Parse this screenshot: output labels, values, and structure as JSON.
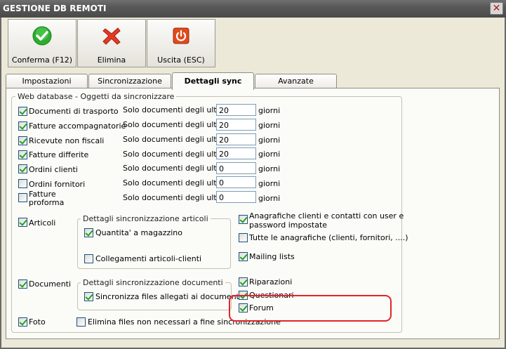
{
  "window": {
    "title": "GESTIONE DB REMOTI",
    "close_glyph": "✕"
  },
  "toolbar": {
    "confirm_label": "Conferma (F12)",
    "delete_label": "Elimina",
    "exit_label": "Uscita (ESC)"
  },
  "tabs": [
    "Impostazioni",
    "Sincronizzazione",
    "Dettagli sync",
    "Avanzate"
  ],
  "active_tab": "Dettagli sync",
  "group_main": {
    "legend": "Web database - Oggetti da sincronizzare"
  },
  "docs": [
    {
      "label": "Documenti di trasporto",
      "checked": true,
      "prefix": "Solo documenti degli ultimi",
      "days": "20",
      "suffix": "giorni"
    },
    {
      "label": "Fatture accompagnatorie",
      "checked": true,
      "prefix": "Solo documenti degli ultimi",
      "days": "20",
      "suffix": "giorni"
    },
    {
      "label": "Ricevute non fiscali",
      "checked": true,
      "prefix": "Solo documenti degli ultimi",
      "days": "20",
      "suffix": "giorni"
    },
    {
      "label": "Fatture differite",
      "checked": true,
      "prefix": "Solo documenti degli ultimi",
      "days": "20",
      "suffix": "giorni"
    },
    {
      "label": "Ordini clienti",
      "checked": true,
      "prefix": "Solo documenti degli ultimi",
      "days": "0",
      "suffix": "giorni"
    },
    {
      "label": "Ordini fornitori",
      "checked": false,
      "prefix": "Solo documenti degli ultimi",
      "days": "0",
      "suffix": "giorni"
    },
    {
      "label_line1": "Fatture",
      "label_line2": "proforma",
      "checked": false,
      "prefix": "Solo documenti degli ultimi",
      "days": "0",
      "suffix": "giorni"
    }
  ],
  "articoli": {
    "label": "Articoli",
    "checked": true,
    "group_legend": "Dettagli sincronizzazione articoli",
    "quantita_label": "Quantita' a magazzino",
    "quantita_checked": true,
    "collegamenti_label": "Collegamenti articoli-clienti",
    "collegamenti_checked": false
  },
  "documenti": {
    "label": "Documenti",
    "checked": true,
    "group_legend": "Dettagli sincronizzazione documenti",
    "allegati_label": "Sincronizza files allegati ai documenti",
    "allegati_checked": true
  },
  "foto": {
    "label": "Foto",
    "checked": true,
    "elimina_label": "Elimina files non necessari a fine sincronizzazione",
    "elimina_checked": false
  },
  "right_options": {
    "anagrafiche_line1": "Anagrafiche clienti e contatti con user e",
    "anagrafiche_line2": "password impostate",
    "anagrafiche_checked": true,
    "tutte_label": "Tutte le anagrafiche (clienti, fornitori, ....)",
    "tutte_checked": false,
    "mailing_label": "Mailing lists",
    "mailing_checked": true,
    "riparazioni_label": "Riparazioni",
    "riparazioni_checked": true,
    "questionari_label": "Questionari",
    "questionari_checked": true,
    "forum_label": "Forum",
    "forum_checked": true
  },
  "colors": {
    "highlight": "#e0252b",
    "check": "#21a121",
    "confirm_icon": "#2cae2c",
    "delete_icon": "#e23a22",
    "exit_icon": "#e04a1c"
  }
}
